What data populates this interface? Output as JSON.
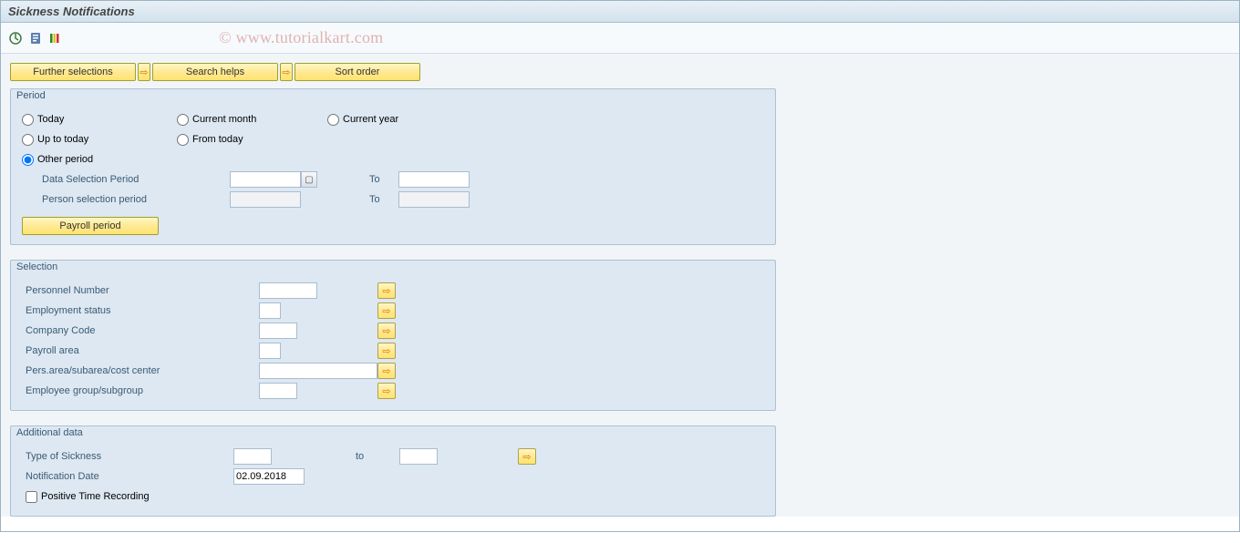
{
  "title": "Sickness Notifications",
  "watermark": "© www.tutorialkart.com",
  "toolbar": {
    "further_selections": "Further selections",
    "search_helps": "Search helps",
    "sort_order": "Sort order"
  },
  "period": {
    "group_label": "Period",
    "today": "Today",
    "current_month": "Current month",
    "current_year": "Current year",
    "up_to_today": "Up to today",
    "from_today": "From today",
    "other_period": "Other period",
    "data_selection": "Data Selection Period",
    "person_selection": "Person selection period",
    "to": "To",
    "payroll_period": "Payroll period"
  },
  "selection": {
    "group_label": "Selection",
    "personnel_number": "Personnel Number",
    "employment_status": "Employment status",
    "company_code": "Company Code",
    "payroll_area": "Payroll area",
    "pers_area": "Pers.area/subarea/cost center",
    "employee_group": "Employee group/subgroup"
  },
  "additional": {
    "group_label": "Additional data",
    "type_of_sickness": "Type of Sickness",
    "to": "to",
    "notification_date": "Notification Date",
    "notification_date_value": "02.09.2018",
    "positive_time_recording": "Positive Time Recording"
  }
}
